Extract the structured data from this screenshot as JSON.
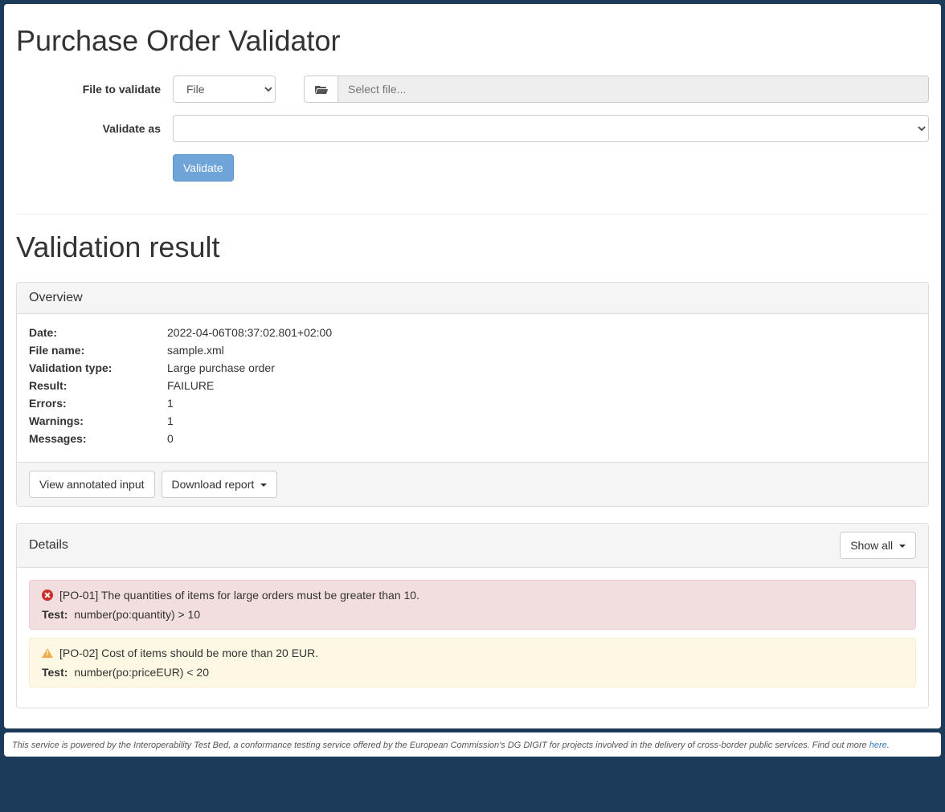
{
  "header": {
    "title": "Purchase Order Validator"
  },
  "form": {
    "file_label": "File to validate",
    "file_select_option": "File",
    "file_placeholder": "Select file...",
    "validate_as_label": "Validate as",
    "validate_as_value": "",
    "validate_button": "Validate"
  },
  "result": {
    "title": "Validation result",
    "overview": {
      "heading": "Overview",
      "rows": [
        {
          "label": "Date:",
          "value": "2022-04-06T08:37:02.801+02:00"
        },
        {
          "label": "File name:",
          "value": "sample.xml"
        },
        {
          "label": "Validation type:",
          "value": "Large purchase order"
        },
        {
          "label": "Result:",
          "value": "FAILURE"
        },
        {
          "label": "Errors:",
          "value": "1"
        },
        {
          "label": "Warnings:",
          "value": "1"
        },
        {
          "label": "Messages:",
          "value": "0"
        }
      ],
      "view_annotated_button": "View annotated input",
      "download_report_button": "Download report"
    },
    "details": {
      "heading": "Details",
      "show_all_button": "Show all",
      "items": [
        {
          "severity": "error",
          "message": "[PO-01] The quantities of items for large orders must be greater than 10.",
          "test_label": "Test:",
          "test_expr": "number(po:quantity) > 10"
        },
        {
          "severity": "warning",
          "message": "[PO-02] Cost of items should be more than 20 EUR.",
          "test_label": "Test:",
          "test_expr": "number(po:priceEUR) < 20"
        }
      ]
    }
  },
  "footer": {
    "text_prefix": "This service is powered by the Interoperability Test Bed, a conformance testing service offered by the European Commission's DG DIGIT for projects involved in the delivery of cross-border public services. Find out more ",
    "link_text": "here",
    "text_suffix": "."
  }
}
